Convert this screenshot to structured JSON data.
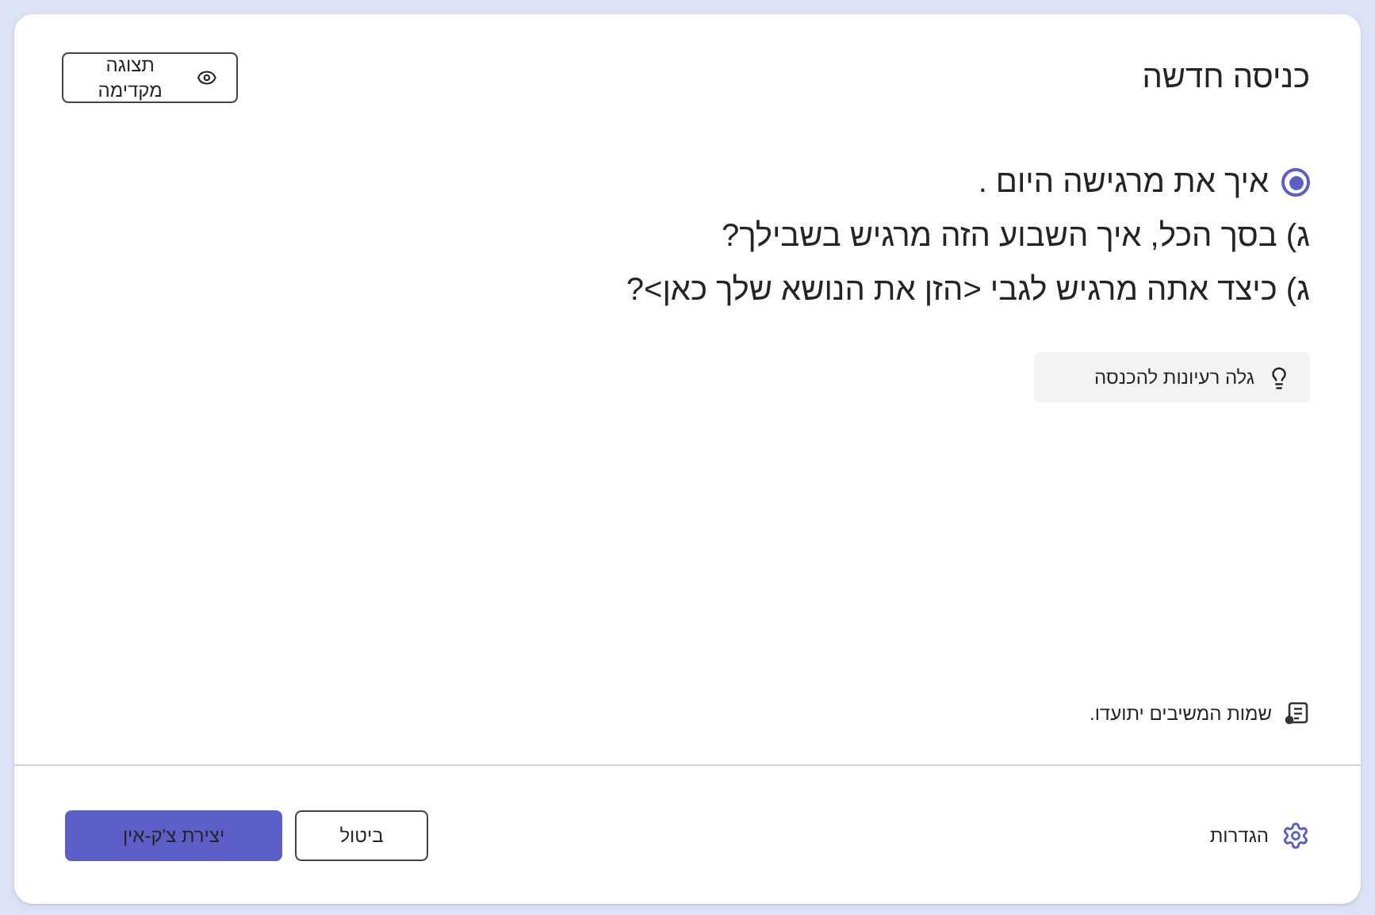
{
  "title": "כניסה חדשה",
  "preview_button": "תצוגה מקדימה",
  "questions": [
    {
      "kind": "radio",
      "selected": true,
      "text": "איך את מרגישה היום ."
    },
    {
      "kind": "plain",
      "text": "ג) בסך הכל, איך השבוע הזה מרגיש בשבילך?"
    },
    {
      "kind": "plain",
      "text": "ג) כיצד אתה מרגיש לגבי <הזן את הנושא שלך כאן>?"
    }
  ],
  "ideas_button": "גלה רעיונות להכנסה",
  "respondents_note": "שמות המשיבים יתועדו.",
  "settings_link": "הגדרות",
  "cancel_button": "ביטול",
  "create_button": "יצירת צ'ק-אין"
}
